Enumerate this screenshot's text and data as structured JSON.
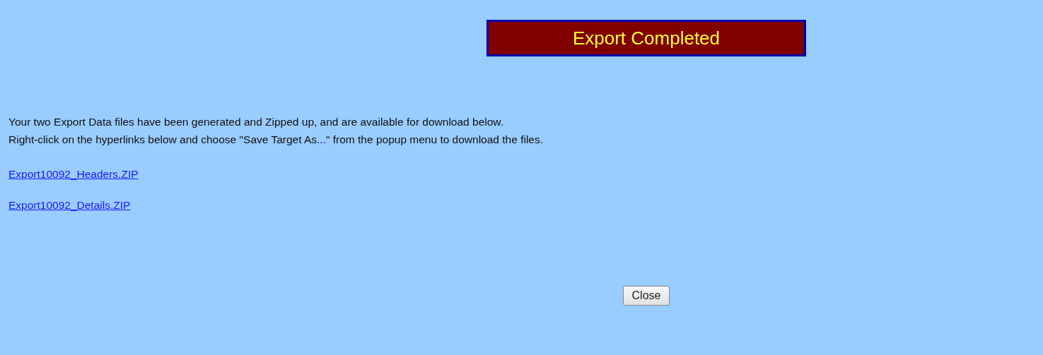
{
  "title": "Export Completed",
  "message_lines": [
    "Your two Export Data files have been generated and Zipped up, and are available for download below.",
    "Right-click on the hyperlinks below and choose \"Save Target As...\" from the popup menu to download the files."
  ],
  "links": [
    "Export10092_Headers.ZIP",
    "Export10092_Details.ZIP"
  ],
  "buttons": [
    "Close"
  ]
}
